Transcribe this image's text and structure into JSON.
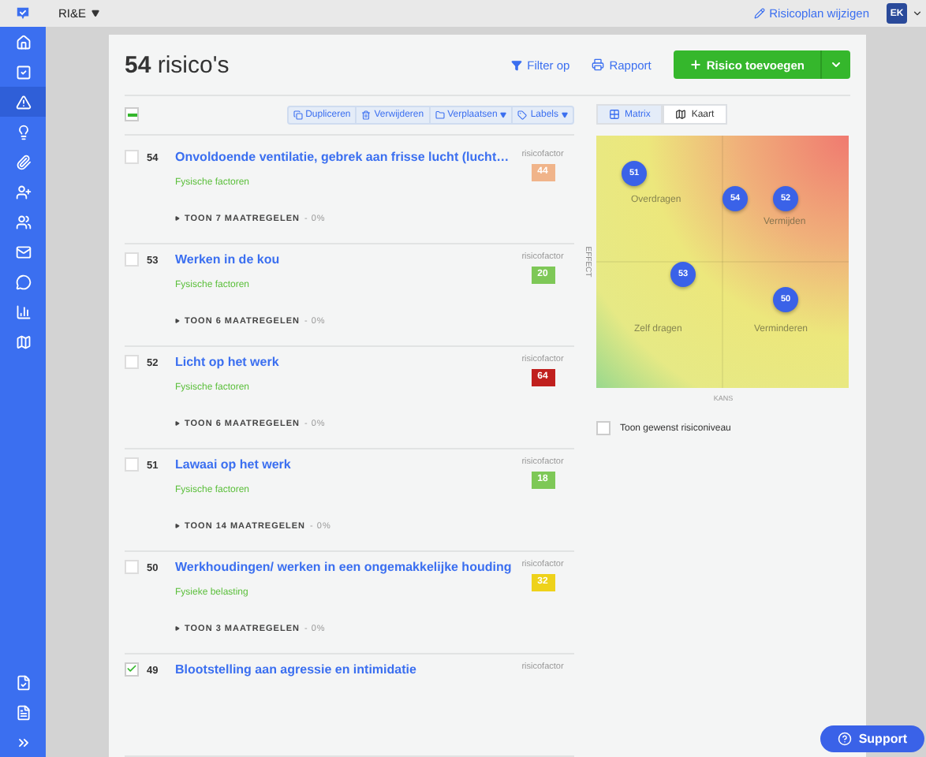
{
  "topbar": {
    "project": "RI&E",
    "edit_link": "Risicoplan wijzigen",
    "user_initials": "EK"
  },
  "sidebar": {
    "items": [
      {
        "selected": false
      },
      {
        "selected": false
      },
      {
        "selected": true
      },
      {
        "selected": false
      },
      {
        "selected": false
      },
      {
        "selected": false
      },
      {
        "selected": false
      },
      {
        "selected": false
      },
      {
        "selected": false
      },
      {
        "selected": false
      },
      {
        "selected": false
      }
    ]
  },
  "header": {
    "count": "54",
    "title": "risico's",
    "filter": "Filter op",
    "report": "Rapport",
    "add": "Risico toevoegen"
  },
  "select_all": {
    "indeterminate": true
  },
  "actions": [
    {
      "label": "Dupliceren",
      "dropdown": false
    },
    {
      "label": "Verwijderen",
      "dropdown": false
    },
    {
      "label": "Verplaatsen",
      "dropdown": true
    },
    {
      "label": "Labels",
      "dropdown": true
    }
  ],
  "risks": [
    {
      "number": "54",
      "title": "Onvoldoende ventilatie, gebrek aan frisse lucht (lucht…",
      "category": "Fysische factoren",
      "factor_label": "risicofactor",
      "factor": "44",
      "color": "#f0b48a",
      "measures": "TOON 7 MAATREGELEN",
      "progress": "- 0%",
      "checked": false
    },
    {
      "number": "53",
      "title": "Werken in de kou",
      "category": "Fysische factoren",
      "factor_label": "risicofactor",
      "factor": "20",
      "color": "#7ec857",
      "measures": "TOON 6 MAATREGELEN",
      "progress": "- 0%",
      "checked": false
    },
    {
      "number": "52",
      "title": "Licht op het werk",
      "category": "Fysische factoren",
      "factor_label": "risicofactor",
      "factor": "64",
      "color": "#c0201e",
      "measures": "TOON 6 MAATREGELEN",
      "progress": "- 0%",
      "checked": false
    },
    {
      "number": "51",
      "title": "Lawaai op het werk",
      "category": "Fysische factoren",
      "factor_label": "risicofactor",
      "factor": "18",
      "color": "#7ec857",
      "measures": "TOON 14 MAATREGELEN",
      "progress": "- 0%",
      "checked": false
    },
    {
      "number": "50",
      "title": "Werkhoudingen/ werken in een ongemakkelijke houding",
      "category": "Fysieke belasting",
      "factor_label": "risicofactor",
      "factor": "32",
      "color": "#eed21a",
      "measures": "TOON 3 MAATREGELEN",
      "progress": "- 0%",
      "checked": false
    },
    {
      "number": "49",
      "title": "Blootstelling aan agressie en intimidatie",
      "factor_label": "risicofactor",
      "checked": true
    }
  ],
  "view_tabs": [
    {
      "label": "Matrix",
      "selected": true
    },
    {
      "label": "Kaart",
      "selected": false
    }
  ],
  "matrix": {
    "y_axis": "EFFECT",
    "x_axis": "KANS",
    "quadrants": [
      "Overdragen",
      "Vermijden",
      "Zelf dragen",
      "Verminderen"
    ],
    "points": [
      "51",
      "54",
      "52",
      "53",
      "50"
    ]
  },
  "desired_level": {
    "label": "Toon gewenst risiconiveau",
    "checked": false
  },
  "support": "Support"
}
